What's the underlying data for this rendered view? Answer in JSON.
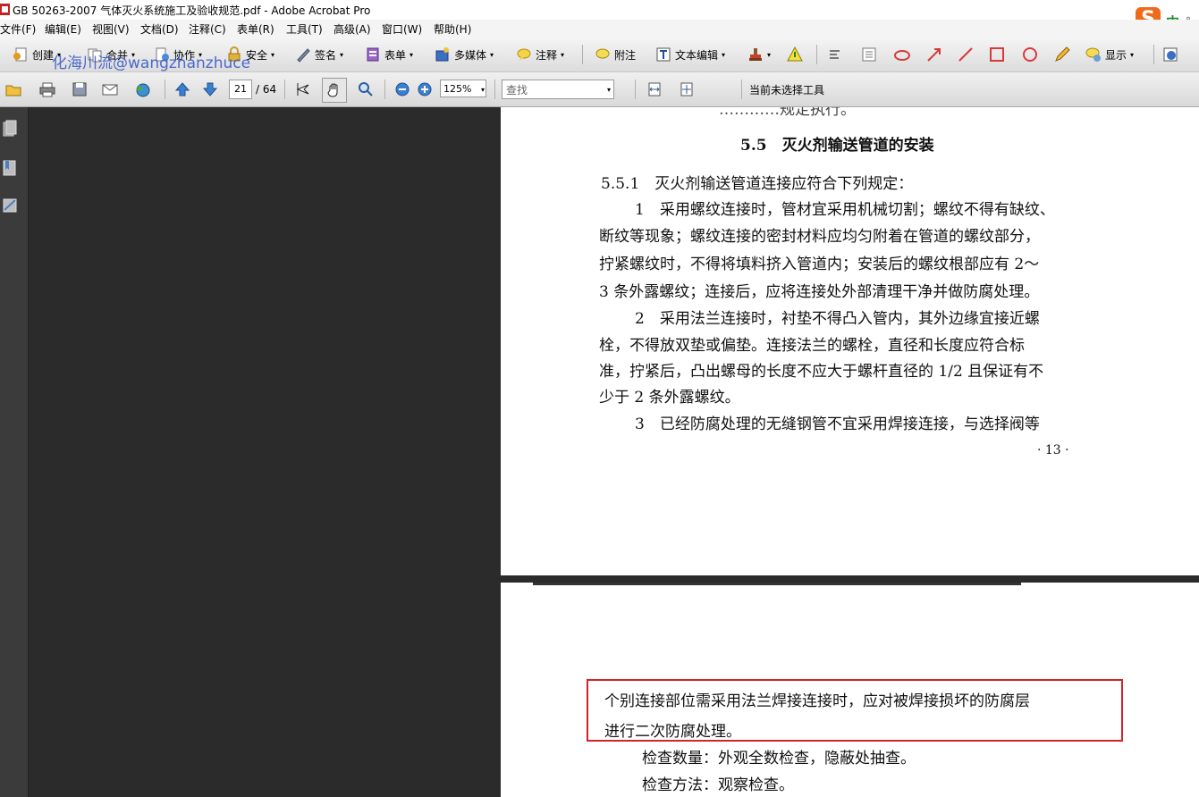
{
  "window": {
    "title": "GB 50263-2007 气体灭火系统施工及验收规范.pdf - Adobe Acrobat Pro"
  },
  "ime": {
    "logo": "S",
    "mode": "中",
    "punct": "°,"
  },
  "menu": [
    "文件(F)",
    "编辑(E)",
    "视图(V)",
    "文档(D)",
    "注释(C)",
    "表单(R)",
    "工具(T)",
    "高级(A)",
    "窗口(W)",
    "帮助(H)"
  ],
  "toolbar1": {
    "create": "创建",
    "combine": "合并",
    "collaborate": "协作",
    "secure": "安全",
    "sign": "签名",
    "forms": "表单",
    "multimedia": "多媒体",
    "comment": "注释",
    "note": "附注",
    "text_edit": "文本编辑",
    "show": "显示",
    "watermark": "化海川流@wangzhanzhuce"
  },
  "toolbar2": {
    "page_current": "21",
    "page_total": "/ 64",
    "zoom": "125%",
    "find_placeholder": "查找",
    "status": "当前未选择工具"
  },
  "page1": {
    "cut_line": "…………规定执行。",
    "section_heading": "5.5　灭火剂输送管道的安装",
    "clause": "5.5.1　灭火剂输送管道连接应符合下列规定：",
    "lines": [
      "1　采用螺纹连接时，管材宜采用机械切割；螺纹不得有缺纹、",
      "断纹等现象；螺纹连接的密封材料应均匀附着在管道的螺纹部分，",
      "拧紧螺纹时，不得将填料挤入管道内；安装后的螺纹根部应有 2～",
      "3 条外露螺纹；连接后，应将连接处外部清理干净并做防腐处理。",
      "2　采用法兰连接时，衬垫不得凸入管内，其外边缘宜接近螺",
      "栓，不得放双垫或偏垫。连接法兰的螺栓，直径和长度应符合标",
      "准，拧紧后，凸出螺母的长度不应大于螺杆直径的 1/2 且保证有不",
      "少于 2 条外露螺纹。",
      "3　已经防腐处理的无缝钢管不宜采用焊接连接，与选择阀等"
    ],
    "page_number": "· 13 ·"
  },
  "page2": {
    "highlight_lines": [
      "个别连接部位需采用法兰焊接连接时，应对被焊接损坏的防腐层",
      "进行二次防腐处理。"
    ],
    "lines": [
      "检查数量：外观全数检查，隐蔽处抽查。",
      "检查方法：观察检查。"
    ]
  }
}
